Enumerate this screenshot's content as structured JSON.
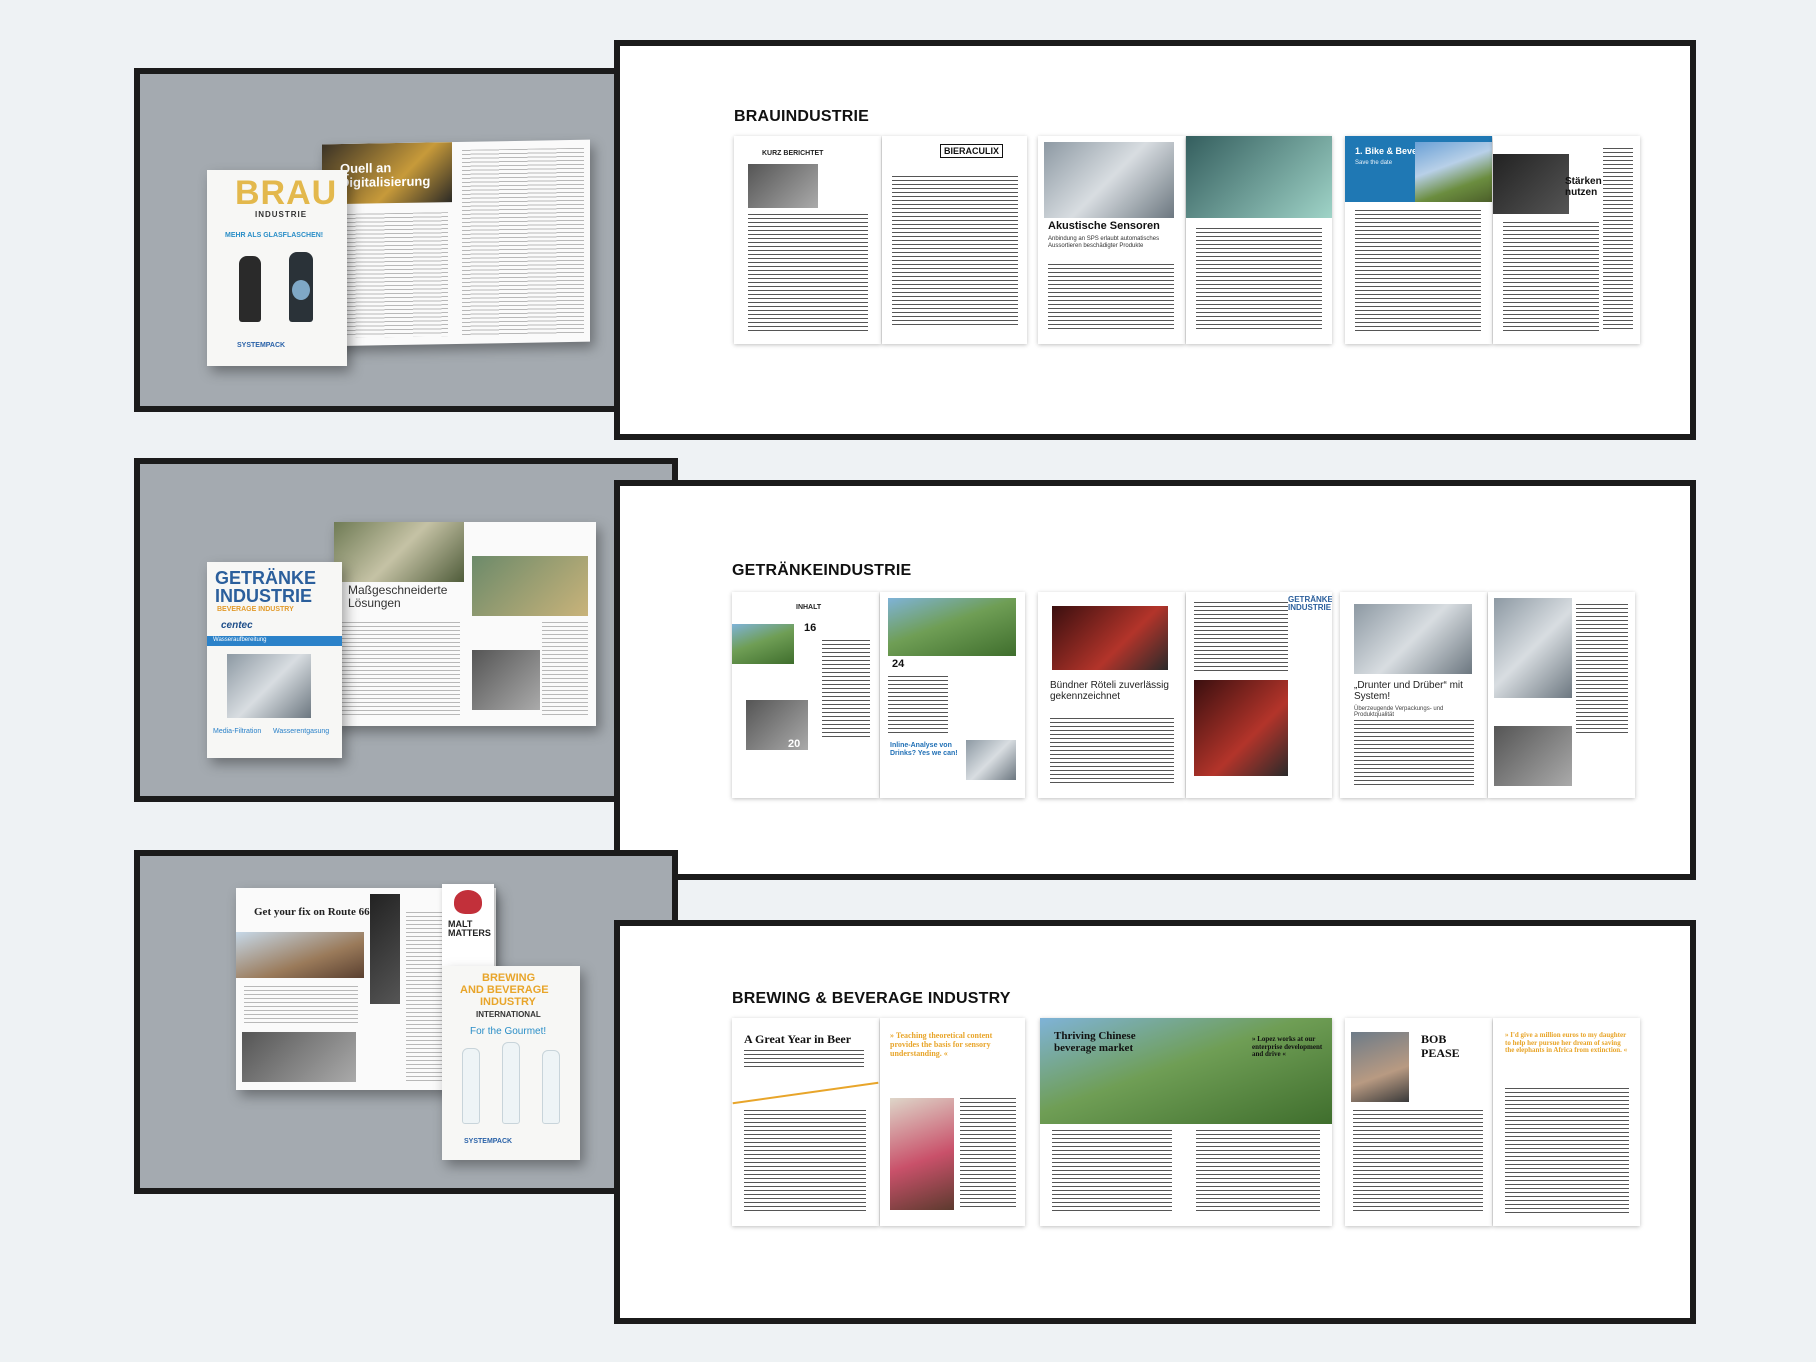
{
  "sections": [
    {
      "title": "BRAUINDUSTRIE",
      "cover": {
        "masthead": "BRAU",
        "subtitle": "INDUSTRIE",
        "headline": "MEHR ALS GLASFLASCHEN!",
        "sponsor": "SYSTEMPACK",
        "feature_title": "Quell an Digitalisierung"
      },
      "pages": {
        "p1_header": "KURZ BERICHTET",
        "p2_logo": "BIERACULIX",
        "p3_title": "Akustische Sensoren",
        "p3_sub": "Anbindung an SPS erlaubt automatisches Aussortieren beschädigter Produkte",
        "p4_title": "1. Bike & Beverage",
        "p4_sub": "Save the date",
        "p5_title": "Stärken nutzen"
      }
    },
    {
      "title": "GETRÄNKEINDUSTRIE",
      "cover": {
        "masthead_line1": "GETRÄNKE",
        "masthead_line2": "INDUSTRIE",
        "tagline": "BEVERAGE INDUSTRY",
        "brand": "centec",
        "topic": "Wasseraufbereitung",
        "feature_title": "Maßgeschneiderte Lösungen",
        "footer_items": [
          "Media-Filtration",
          "Wasserentgasung"
        ]
      },
      "pages": {
        "p1_header": "INHALT",
        "p1_num1": "16",
        "p1_num2": "20",
        "p2_num": "24",
        "p2_ad": "Inline-Analyse von Drinks? Yes we can!",
        "p3_title": "Bündner Röteli zuverlässig gekennzeichnet",
        "p4_masthead": "GETRÄNKE INDUSTRIE",
        "p5_title": "„Drunter und Drüber“ mit System!",
        "p5_sub": "Überzeugende Verpackungs- und Produktqualität"
      }
    },
    {
      "title": "BREWING & BEVERAGE INDUSTRY",
      "cover": {
        "spread_title": "Get your fix on Route 66",
        "badge": "MALT MATTERS",
        "masthead_line1": "BREWING",
        "masthead_line2": "AND BEVERAGE",
        "masthead_line3": "INDUSTRY",
        "masthead_line4": "INTERNATIONAL",
        "headline": "For the Gourmet!",
        "sponsor": "SYSTEMPACK"
      },
      "pages": {
        "p1_title": "A Great Year in Beer",
        "p1_quote": "» Teaching theoretical content provides the basis for sensory understanding. «",
        "p2_title": "Thriving Chinese beverage market",
        "p2_quote": "» Lopez works at our enterprise development and drive «",
        "p3_name_line1": "BOB",
        "p3_name_line2": "PEASE",
        "p3_quote": "» I'd give a million euros to my daughter to help her pursue her dream of saving the elephants in Africa from extinction. «"
      }
    }
  ]
}
